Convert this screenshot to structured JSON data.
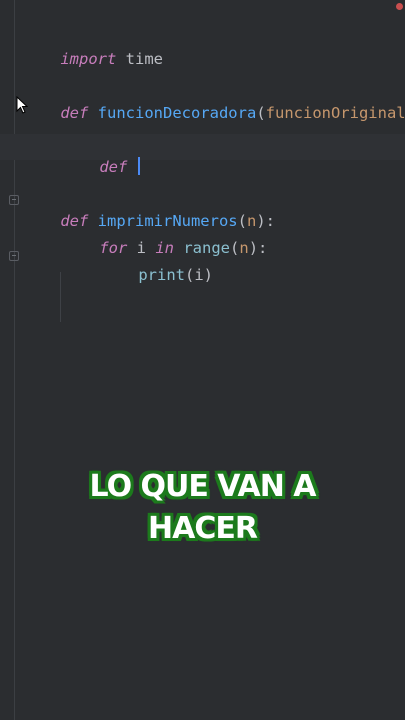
{
  "code": {
    "line1": {
      "kw": "import",
      "rest": " time"
    },
    "line2": {
      "kw": "def",
      "fn": " funcionDecoradora",
      "open": "(",
      "param": "funcionOriginal",
      "close": "):"
    },
    "line3": {
      "kw": "def",
      "rest": " "
    },
    "line4": {
      "kw": "def",
      "fn": " imprimirNumeros",
      "open": "(",
      "param": "n",
      "close": "):"
    },
    "line5": {
      "kw_for": "for",
      "var": " i ",
      "kw_in": "in",
      "builtin": " range",
      "open": "(",
      "param": "n",
      "close": "):"
    },
    "line6": {
      "builtin": "print",
      "args": "(i)"
    }
  },
  "caption": {
    "line1": "LO QUE VAN A",
    "line2": "HACER"
  },
  "colors": {
    "background": "#2b2d30",
    "keyword": "#c77dbb",
    "function": "#56a8f5",
    "parameter": "#c6976d",
    "builtin": "#8bc0d0",
    "caption_outline": "#1c7a1c"
  },
  "icons": [
    "mouse-pointer-icon",
    "fold-icon",
    "error-indicator-icon"
  ]
}
